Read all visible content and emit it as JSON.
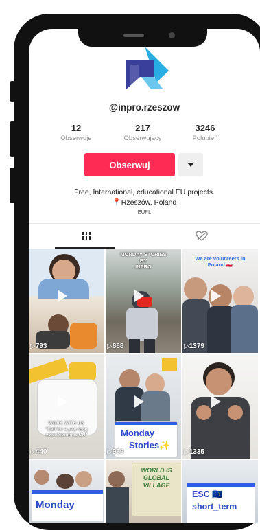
{
  "profile": {
    "username": "@inpro.rzeszow",
    "stats": [
      {
        "value": "12",
        "label": "Obserwuje"
      },
      {
        "value": "217",
        "label": "Obserwujący"
      },
      {
        "value": "3246",
        "label": "Polubień"
      }
    ],
    "follow_label": "Obserwuj",
    "bio_line1": "Free, International, educational EU projects.",
    "bio_line2": "📍Rzeszów, Poland",
    "link": "EUPL"
  },
  "tabs": [
    {
      "icon": "grid-icon"
    },
    {
      "icon": "liked-videos-icon"
    }
  ],
  "videos": [
    {
      "views": "793"
    },
    {
      "views": "868",
      "title_lines": [
        "MONDAY STORIES",
        "BY",
        "INPRO"
      ]
    },
    {
      "views": "1379",
      "caption": "We are volunteers in Poland 🇵🇱"
    },
    {
      "views": "440",
      "caption_top": "WORK WITH US",
      "caption": "\"Call for a year long volunteering is ON\""
    },
    {
      "views": "959",
      "card_lines": [
        "Monday",
        "Stories✨"
      ]
    },
    {
      "views": "1335"
    },
    {
      "card_line": "Monday"
    },
    {
      "sign_text": "WORLD IS GLOBAL VILLAGE"
    },
    {
      "card_lines": [
        "ESC 🇪🇺",
        "short_term"
      ]
    }
  ],
  "colors": {
    "accent": "#fe2c55",
    "logo_blue": "#3b3f9c",
    "logo_cyan": "#29aee3"
  }
}
